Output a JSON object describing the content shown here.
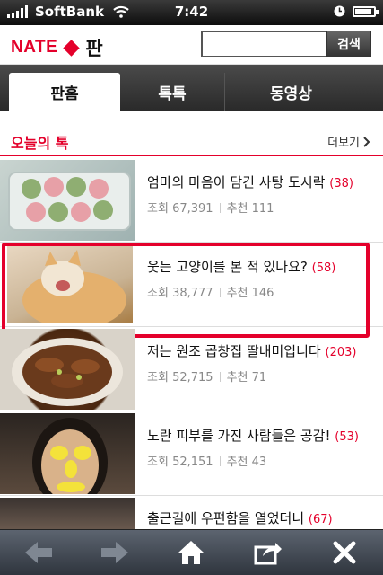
{
  "status": {
    "carrier": "SoftBank",
    "time": "7:42"
  },
  "header": {
    "logo_text": "NATE",
    "logo_sub": "판",
    "search_placeholder": "",
    "search_button": "검색"
  },
  "tabs": [
    {
      "label": "판홈",
      "active": true
    },
    {
      "label": "톡톡",
      "active": false
    },
    {
      "label": "동영상",
      "active": false
    }
  ],
  "section": {
    "title": "오늘의 톡",
    "more": "더보기"
  },
  "items": [
    {
      "title": "엄마의 마음이 담긴 사탕 도시락",
      "count": "(38)",
      "views_label": "조회",
      "views": "67,391",
      "rec_label": "추천",
      "rec": "111"
    },
    {
      "title": "웃는 고양이를 본 적 있나요?",
      "count": "(58)",
      "views_label": "조회",
      "views": "38,777",
      "rec_label": "추천",
      "rec": "146"
    },
    {
      "title": "저는 원조 곱창집 딸내미입니다",
      "count": "(203)",
      "views_label": "조회",
      "views": "52,715",
      "rec_label": "추천",
      "rec": "71"
    },
    {
      "title": "노란 피부를 가진 사람들은 공감!",
      "count": "(53)",
      "views_label": "조회",
      "views": "52,151",
      "rec_label": "추천",
      "rec": "43"
    },
    {
      "title": "출근길에 우편함을 열었더니",
      "count": "(67)"
    }
  ],
  "colors": {
    "accent": "#e4002b",
    "count": "#e4002b"
  }
}
